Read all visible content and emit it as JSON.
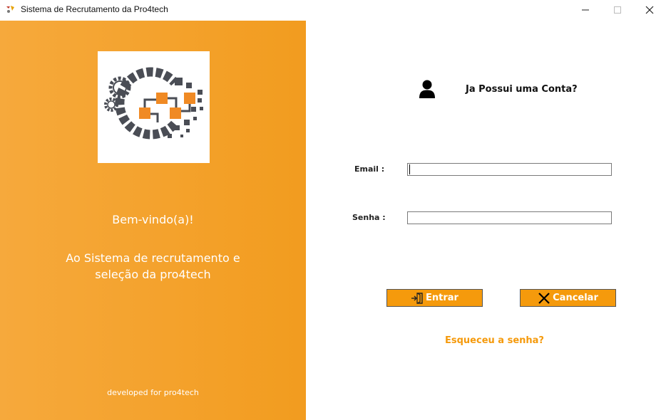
{
  "window": {
    "title": "Sistema de Recrutamento da Pro4tech"
  },
  "left_panel": {
    "welcome": "Bem-vindo(a)!",
    "subtitle_line1": "Ao Sistema de recrutamento e",
    "subtitle_line2": "seleção da pro4tech",
    "footer": "developed for pro4tech",
    "logo_icon": "gears-logo"
  },
  "login": {
    "heading": "Ja Possui uma Conta?",
    "user_icon": "person-icon",
    "email_label": "Email :",
    "email_value": "",
    "password_label": "Senha :",
    "password_value": "",
    "enter_label": "Entrar",
    "cancel_label": "Cancelar",
    "forgot_label": "Esqueceu a senha?"
  },
  "colors": {
    "accent": "#f59a0c",
    "panel_start": "#f6a93c",
    "panel_end": "#f29c1f",
    "logo_dark": "#4a4d55"
  }
}
